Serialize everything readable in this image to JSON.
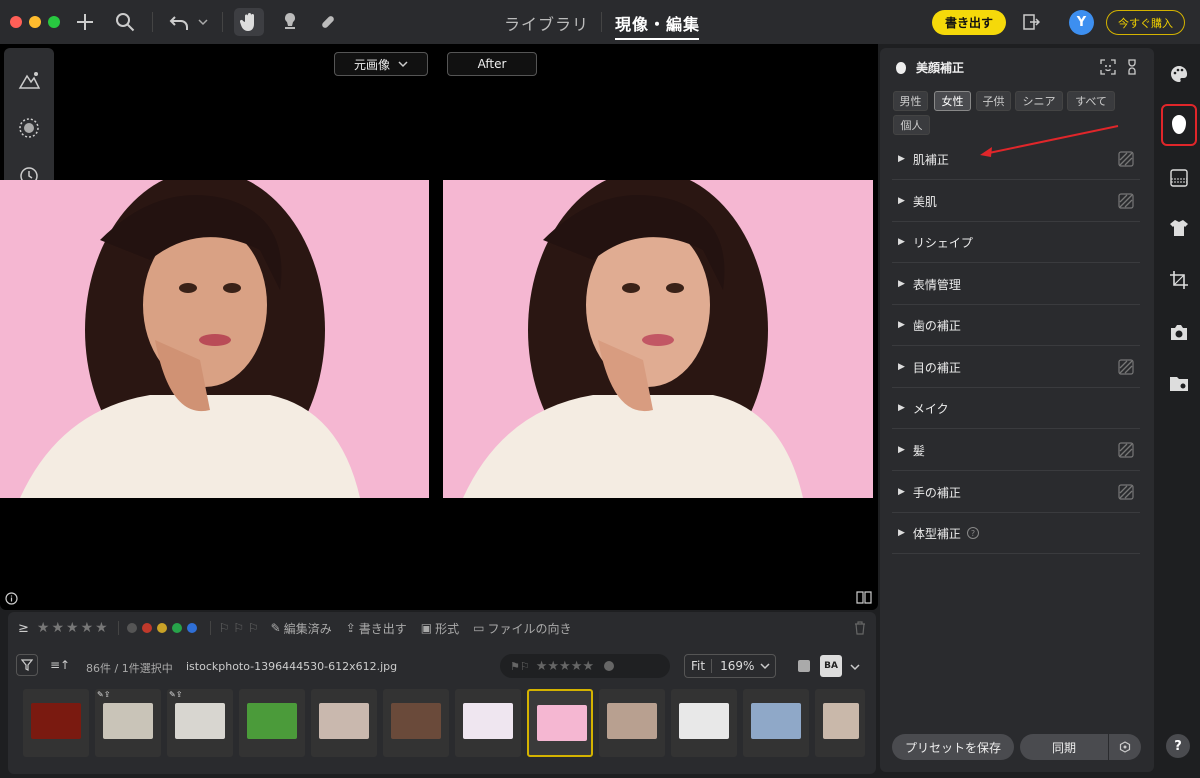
{
  "topbar": {
    "tabs": [
      {
        "label": "ライブラリ"
      },
      {
        "label": "現像・編集"
      }
    ],
    "export_label": "書き出す",
    "avatar_initial": "Y",
    "buy_label": "今すぐ購入"
  },
  "viewer": {
    "original_select": "元画像",
    "after_label": "After"
  },
  "filmstrip": {
    "compare_symbol": "≥",
    "edited_label": "編集済み",
    "export_label": "書き出す",
    "format_label": "形式",
    "orientation_label": "ファイルの向き",
    "count_text": "86件 / 1件選択中",
    "filename": "istockphoto-1396444530-612x612.jpg",
    "fit_label": "Fit",
    "zoom": "169%",
    "ba_label": "BA",
    "label_colors": [
      "#555555",
      "#c0392b",
      "#c9a227",
      "#27a34a",
      "#2f6fd6"
    ]
  },
  "panel": {
    "title": "美顔補正",
    "chips": [
      {
        "label": "男性"
      },
      {
        "label": "女性"
      },
      {
        "label": "子供"
      },
      {
        "label": "シニア"
      },
      {
        "label": "すべて"
      },
      {
        "label": "個人"
      }
    ],
    "sections": [
      {
        "label": "肌補正"
      },
      {
        "label": "美肌"
      },
      {
        "label": "リシェイプ"
      },
      {
        "label": "表情管理"
      },
      {
        "label": "歯の補正"
      },
      {
        "label": "目の補正"
      },
      {
        "label": "メイク"
      },
      {
        "label": "髪"
      },
      {
        "label": "手の補正"
      },
      {
        "label": "体型補正"
      }
    ],
    "preset_label": "プリセットを保存",
    "sync_label": "同期"
  },
  "rail": {
    "icons": [
      "palette-icon",
      "face-icon",
      "gradient-icon",
      "shirt-icon",
      "crop-icon",
      "camera-icon",
      "folder-icon"
    ],
    "help": "?"
  },
  "colors": {
    "accent": "#f5d90a",
    "highlight": "#e0262a",
    "photo_bg": "#f5b7d2"
  }
}
